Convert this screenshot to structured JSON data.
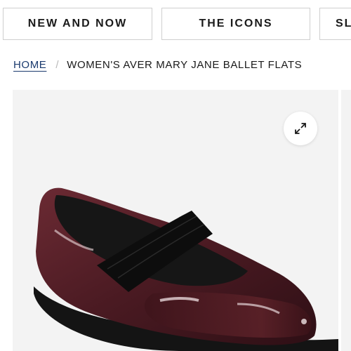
{
  "categories": {
    "items": [
      {
        "label": "NEW AND NOW"
      },
      {
        "label": "THE ICONS"
      },
      {
        "label": "SL"
      }
    ]
  },
  "breadcrumb": {
    "home": "HOME",
    "separator": "/",
    "current": "WOMEN'S AVER MARY JANE BALLET FLATS"
  },
  "gallery": {
    "expand_icon": "expand-arrows-icon",
    "image": "product-shoe-photo",
    "shoe_color": "#4a1a22",
    "background_color": "#f3f3f3"
  }
}
